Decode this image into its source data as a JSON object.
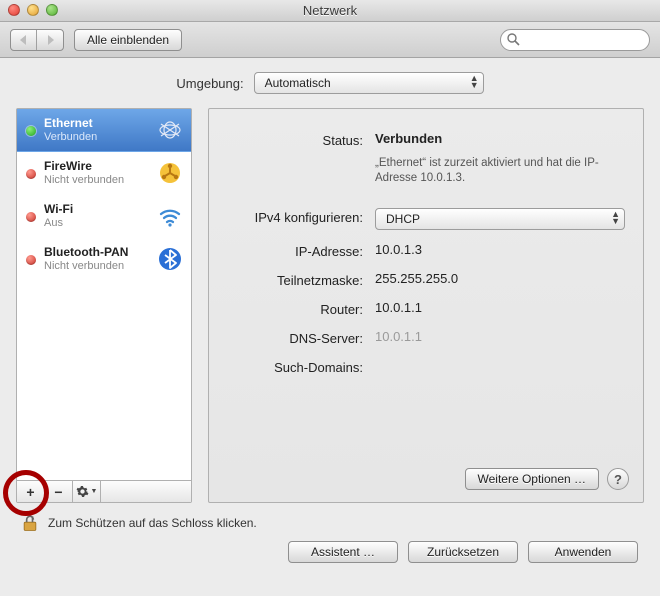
{
  "window": {
    "title": "Netzwerk"
  },
  "toolbar": {
    "show_all": "Alle einblenden",
    "search_placeholder": ""
  },
  "environment": {
    "label": "Umgebung:",
    "value": "Automatisch"
  },
  "services": [
    {
      "name": "Ethernet",
      "status_label": "Verbunden",
      "status": "green",
      "icon": "ethernet"
    },
    {
      "name": "FireWire",
      "status_label": "Nicht verbunden",
      "status": "red",
      "icon": "firewire"
    },
    {
      "name": "Wi-Fi",
      "status_label": "Aus",
      "status": "red",
      "icon": "wifi"
    },
    {
      "name": "Bluetooth-PAN",
      "status_label": "Nicht verbunden",
      "status": "red",
      "icon": "bluetooth"
    }
  ],
  "detail": {
    "status_label": "Status:",
    "status_value": "Verbunden",
    "status_desc": "„Ethernet“ ist zurzeit aktiviert und hat die IP-Adresse 10.0.1.3.",
    "ipv4_label": "IPv4 konfigurieren:",
    "ipv4_value": "DHCP",
    "ip_label": "IP-Adresse:",
    "ip_value": "10.0.1.3",
    "mask_label": "Teilnetzmaske:",
    "mask_value": "255.255.255.0",
    "router_label": "Router:",
    "router_value": "10.0.1.1",
    "dns_label": "DNS-Server:",
    "dns_value": "10.0.1.1",
    "domains_label": "Such-Domains:",
    "domains_value": "",
    "advanced": "Weitere Optionen …"
  },
  "lock": {
    "text": "Zum Schützen auf das Schloss klicken."
  },
  "buttons": {
    "assist": "Assistent …",
    "revert": "Zurücksetzen",
    "apply": "Anwenden"
  }
}
